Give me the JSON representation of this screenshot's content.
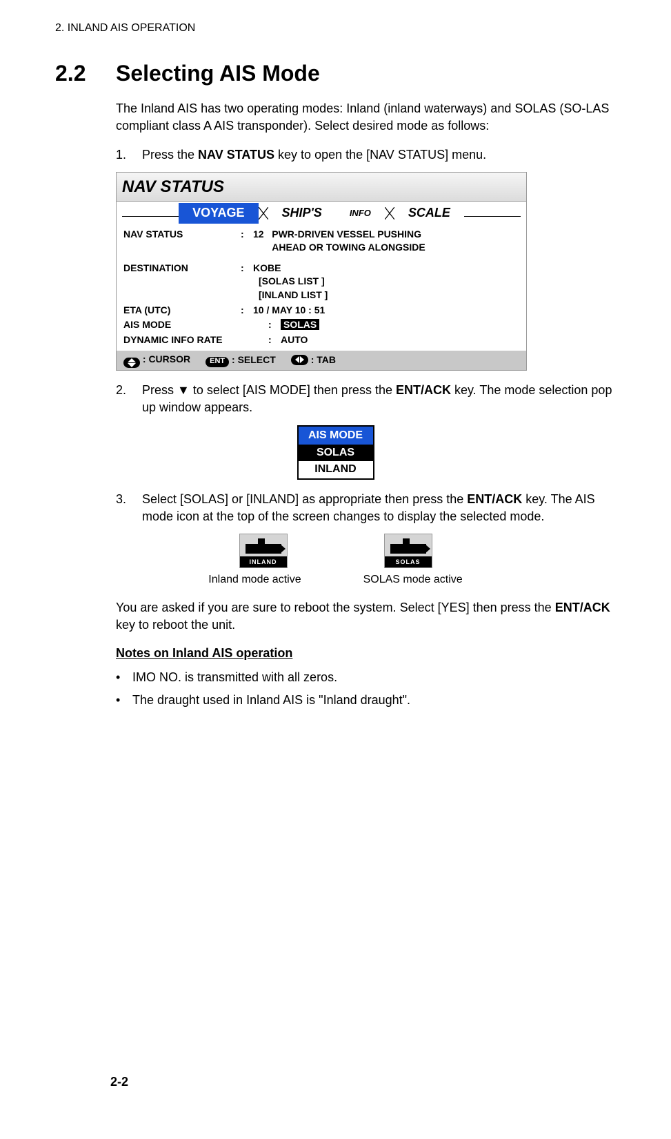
{
  "chapter_header": "2.  INLAND AIS OPERATION",
  "section": {
    "number": "2.2",
    "title": "Selecting AIS Mode"
  },
  "intro": "The Inland AIS has two operating modes: Inland (inland waterways) and SOLAS (SO-LAS compliant class A AIS transponder). Select desired mode as follows:",
  "steps": {
    "s1": {
      "num": "1.",
      "text_a": "Press the ",
      "bold": "NAV STATUS",
      "text_b": " key to open the [NAV STATUS] menu."
    },
    "s2": {
      "num": "2.",
      "text_a": "Press ",
      "text_b": " to select [AIS MODE] then press the ",
      "bold": "ENT/ACK",
      "text_c": " key. The mode selection pop up window appears."
    },
    "s3": {
      "num": "3.",
      "text_a": "Select [SOLAS] or [INLAND] as appropriate then press the ",
      "bold": "ENT/ACK",
      "text_b": " key. The AIS mode icon at the top of the screen changes to display the selected mode."
    }
  },
  "nav_figure": {
    "title": "NAV STATUS",
    "tabs": {
      "voyage": "VOYAGE",
      "ships": "SHIP'S",
      "info": "INFO",
      "scale": "SCALE"
    },
    "rows": {
      "nav_status": {
        "label": "NAV STATUS",
        "value": "12",
        "desc1": "PWR-DRIVEN VESSEL PUSHING",
        "desc2": "AHEAD OR TOWING ALONGSIDE"
      },
      "destination": {
        "label": "DESTINATION",
        "value": "KOBE",
        "list1": "[SOLAS  LIST ]",
        "list2": "[INLAND  LIST ]"
      },
      "eta": {
        "label": "ETA (UTC)",
        "value": "10 / MAY 10 : 51"
      },
      "ais_mode": {
        "label": "AIS MODE",
        "value": "SOLAS"
      },
      "dyn": {
        "label": "DYNAMIC INFO RATE",
        "value": "AUTO"
      }
    },
    "help": {
      "cursor": ": CURSOR",
      "ent": "ENT",
      "select": ": SELECT",
      "tab": ": TAB"
    }
  },
  "popup": {
    "header": "AIS MODE",
    "opt1": "SOLAS",
    "opt2": "INLAND"
  },
  "icons": {
    "inland_label": "INLAND",
    "solas_label": "SOLAS",
    "cap_inland": "Inland mode active",
    "cap_solas": "SOLAS mode active"
  },
  "reboot": {
    "a": "You are asked if you are sure to reboot the system. Select [YES] then press the ",
    "bold": "ENT/ACK",
    "b": " key to reboot the unit."
  },
  "notes": {
    "title": "Notes on Inland AIS operation",
    "b1": "IMO NO. is transmitted with all zeros.",
    "b2": "The draught used in Inland AIS is \"Inland draught\"."
  },
  "footer": "2-2"
}
